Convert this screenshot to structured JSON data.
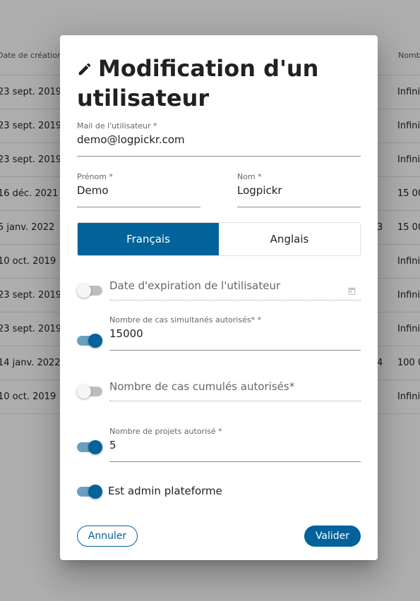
{
  "background_table": {
    "header_left": "Date de création",
    "header_right": "Nomb",
    "rows": [
      {
        "date": "23 sept. 2019",
        "right": "Infini",
        "mid": ""
      },
      {
        "date": "23 sept. 2019",
        "right": "Infini",
        "mid": ""
      },
      {
        "date": "23 sept. 2019",
        "right": "Infini",
        "mid": ""
      },
      {
        "date": "16 déc. 2021",
        "right": "15 00",
        "mid": ""
      },
      {
        "date": "5 janv. 2022",
        "right": "15 00",
        "mid": "3"
      },
      {
        "date": "10 oct. 2019",
        "right": "Infini",
        "mid": ""
      },
      {
        "date": "23 sept. 2019",
        "right": "Infini",
        "mid": ""
      },
      {
        "date": "23 sept. 2019",
        "right": "Infini",
        "mid": ""
      },
      {
        "date": "14 janv. 2022",
        "right": "100 0",
        "mid": "4"
      },
      {
        "date": "10 oct. 2019",
        "right": "Infini",
        "mid": ""
      }
    ]
  },
  "dialog": {
    "title": "Modification d'un utilisateur",
    "title_icon": "pencil-icon",
    "email": {
      "label": "Mail de l'utilisateur *",
      "value": "demo@logpickr.com"
    },
    "firstname": {
      "label": "Prénom *",
      "value": "Demo"
    },
    "lastname": {
      "label": "Nom *",
      "value": "Logpickr"
    },
    "languages": {
      "options": [
        "Français",
        "Anglais"
      ],
      "selected": "Français"
    },
    "expiration": {
      "enabled": false,
      "placeholder": "Date d'expiration de l'utilisateur",
      "icon": "calendar-icon"
    },
    "simultaneous_cases": {
      "enabled": true,
      "label": "Nombre de cas simultanés autorisés* *",
      "value": "15000"
    },
    "cumulated_cases": {
      "enabled": false,
      "placeholder": "Nombre de cas cumulés autorisés*"
    },
    "projects": {
      "enabled": true,
      "label": "Nombre de projets autorisé *",
      "value": "5"
    },
    "platform_admin": {
      "enabled": true,
      "label": "Est admin plateforme"
    },
    "cancel_label": "Annuler",
    "submit_label": "Valider"
  },
  "colors": {
    "primary": "#02629a",
    "toggle_track_on": "#6a9fbf",
    "overlay": "rgba(0,0,0,0.32)"
  }
}
